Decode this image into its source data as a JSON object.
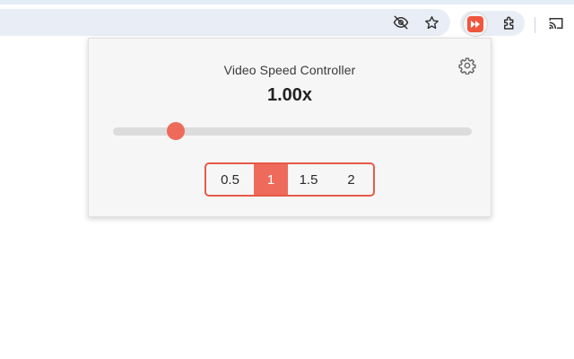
{
  "toolbar": {
    "icons": [
      "eye-slash-icon",
      "star-icon",
      "video-speed-extension-icon",
      "extensions-puzzle-icon",
      "cast-icon"
    ]
  },
  "popup": {
    "title": "Video Speed Controller",
    "speed_display": "1.00x",
    "settings_icon": "gear-icon",
    "slider": {
      "value": 1.0,
      "level": 0.176
    },
    "presets": [
      {
        "label": "0.5",
        "selected": false
      },
      {
        "label": "1",
        "selected": true
      },
      {
        "label": "1.5",
        "selected": false
      },
      {
        "label": "2",
        "selected": false
      }
    ]
  },
  "colors": {
    "accent": "#ee6b5b",
    "accent_border": "#e65a48",
    "popup_bg": "#f6f6f6",
    "track": "#dcdcdc",
    "extension_icon": "#f0563e"
  }
}
